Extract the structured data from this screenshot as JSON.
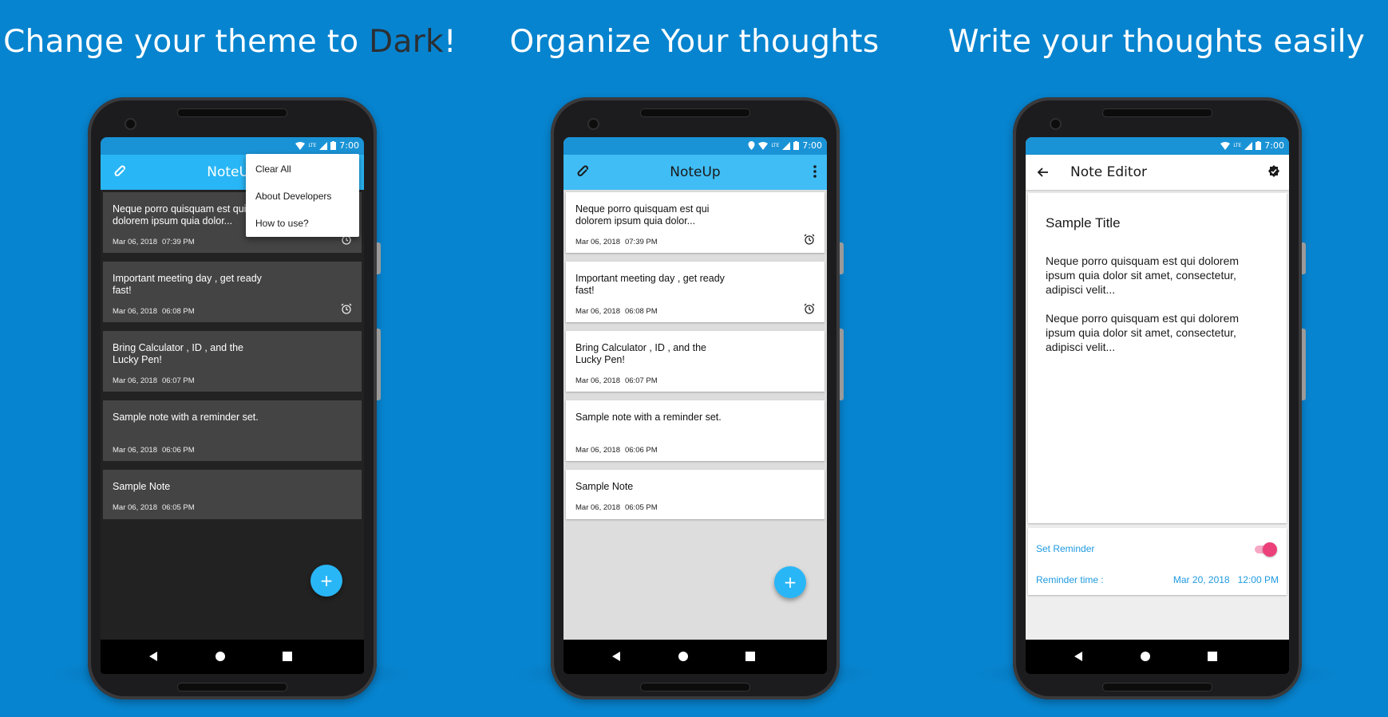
{
  "colors": {
    "background": "#0784cf",
    "accent_blue": "#29b6f6",
    "dark_bg": "#222222",
    "dark_card": "#444444",
    "dark_appbar": "#29b6f6",
    "toggle_pink": "#ec407a"
  },
  "status_bar": {
    "time": "7:00",
    "network": "LTE"
  },
  "panels": [
    {
      "headline_prefix": "Change your theme to ",
      "headline_highlight": "Dark",
      "headline_suffix": "!",
      "app_title": "NoteUp",
      "menu": {
        "items": [
          {
            "label": "Clear All"
          },
          {
            "label": "About Developers"
          },
          {
            "label": "How to use?"
          }
        ]
      },
      "notes": [
        {
          "text": "Neque porro quisquam est qui dolorem ipsum quia dolor...",
          "date": "Mar 06, 2018",
          "time": "07:39 PM",
          "alarm": true
        },
        {
          "text": "Important meeting day , get ready fast!",
          "date": "Mar 06, 2018",
          "time": "06:08 PM",
          "alarm": true
        },
        {
          "text": "Bring Calculator , ID , and the Lucky Pen!",
          "date": "Mar 06, 2018",
          "time": "06:07 PM",
          "alarm": false
        },
        {
          "text": "Sample note with a reminder set.",
          "date": "Mar 06, 2018",
          "time": "06:06 PM",
          "alarm": false
        },
        {
          "text": "Sample Note",
          "date": "Mar 06, 2018",
          "time": "06:05 PM",
          "alarm": false
        }
      ],
      "fab_label": "+"
    },
    {
      "headline": "Organize Your thoughts",
      "app_title": "NoteUp",
      "notes": [
        {
          "text": "Neque porro quisquam est qui dolorem ipsum quia dolor...",
          "date": "Mar 06, 2018",
          "time": "07:39 PM",
          "alarm": true
        },
        {
          "text": "Important meeting day , get ready fast!",
          "date": "Mar 06, 2018",
          "time": "06:08 PM",
          "alarm": true
        },
        {
          "text": "Bring Calculator , ID , and the Lucky Pen!",
          "date": "Mar 06, 2018",
          "time": "06:07 PM",
          "alarm": false
        },
        {
          "text": "Sample note with a reminder set.",
          "date": "Mar 06, 2018",
          "time": "06:06 PM",
          "alarm": false
        },
        {
          "text": "Sample Note",
          "date": "Mar 06, 2018",
          "time": "06:05 PM",
          "alarm": false
        }
      ],
      "fab_label": "+"
    },
    {
      "headline": "Write your thoughts easily",
      "app_title": "Note Editor",
      "note_title": "Sample Title",
      "note_paragraphs": [
        "Neque porro quisquam est qui dolorem ipsum quia dolor sit amet, consectetur, adipisci velit...",
        "Neque porro quisquam est qui dolorem ipsum quia dolor sit amet, consectetur, adipisci velit..."
      ],
      "set_reminder_label": "Set Reminder",
      "reminder_enabled": true,
      "reminder_time_label": "Reminder time :",
      "reminder_date": "Mar 20, 2018",
      "reminder_time": "12:00 PM"
    }
  ]
}
